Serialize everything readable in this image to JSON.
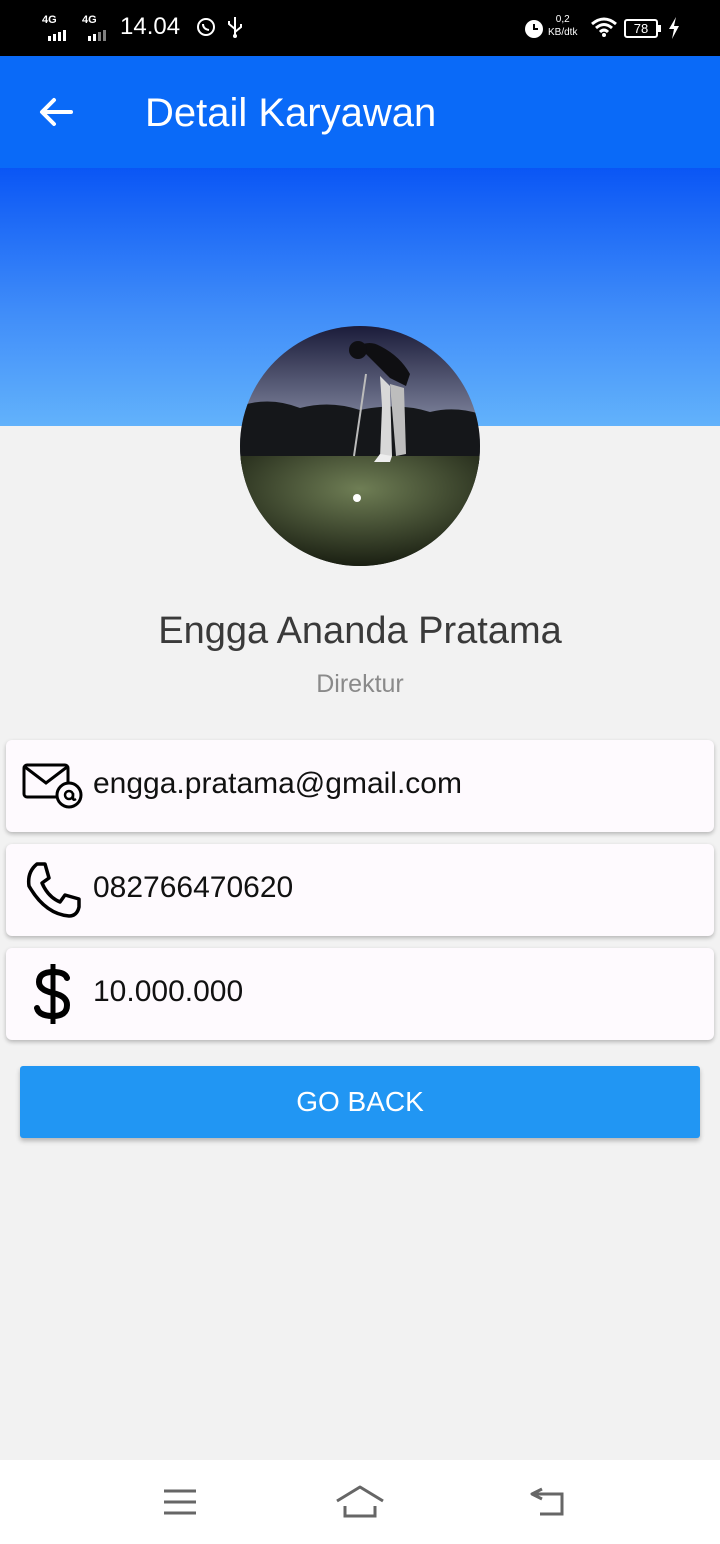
{
  "status_bar": {
    "network1": "4G",
    "network2": "4G",
    "time": "14.04",
    "speed_value": "0,2",
    "speed_unit": "KB/dtk",
    "battery": "78"
  },
  "app_bar": {
    "title": "Detail Karyawan"
  },
  "profile": {
    "name": "Engga Ananda Pratama",
    "role": "Direktur"
  },
  "details": {
    "email": "engga.pratama@gmail.com",
    "phone": "082766470620",
    "salary": "10.000.000"
  },
  "actions": {
    "go_back_label": "GO BACK"
  },
  "colors": {
    "app_bar": "#0a6af8",
    "button": "#2196f3",
    "background": "#f2f2f2"
  }
}
